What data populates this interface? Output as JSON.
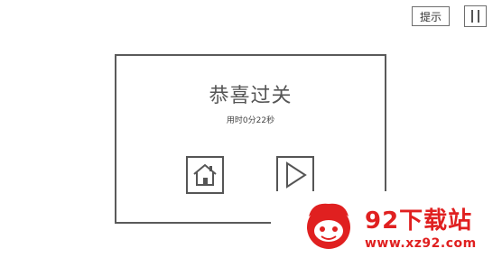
{
  "toolbar": {
    "hint_label": "提示",
    "pause_icon": "pause-icon"
  },
  "dialog": {
    "title": "恭喜过关",
    "subtitle": "用时0分22秒",
    "home_icon": "home-icon",
    "next_icon": "play-icon"
  },
  "watermark": {
    "brand": "92下载站",
    "url": "www.xz92.com",
    "color": "#e02020"
  }
}
